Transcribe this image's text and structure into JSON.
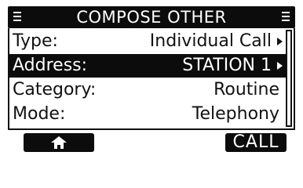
{
  "header": {
    "title": "COMPOSE OTHER",
    "left_icon": "menu-icon",
    "right_icon": "menu-icon"
  },
  "rows": [
    {
      "label": "Type:",
      "value": "Individual Call",
      "arrow": true,
      "selected": false
    },
    {
      "label": "Address:",
      "value": "STATION 1",
      "arrow": true,
      "selected": true
    },
    {
      "label": "Category:",
      "value": "Routine",
      "arrow": false,
      "selected": false
    },
    {
      "label": "Mode:",
      "value": "Telephony",
      "arrow": false,
      "selected": false
    }
  ],
  "softkeys": {
    "left_icon": "home-icon",
    "right_label": "CALL"
  },
  "colors": {
    "foreground": "#111111",
    "highlight_bg": "#0c0c0c",
    "background": "#ffffff"
  }
}
